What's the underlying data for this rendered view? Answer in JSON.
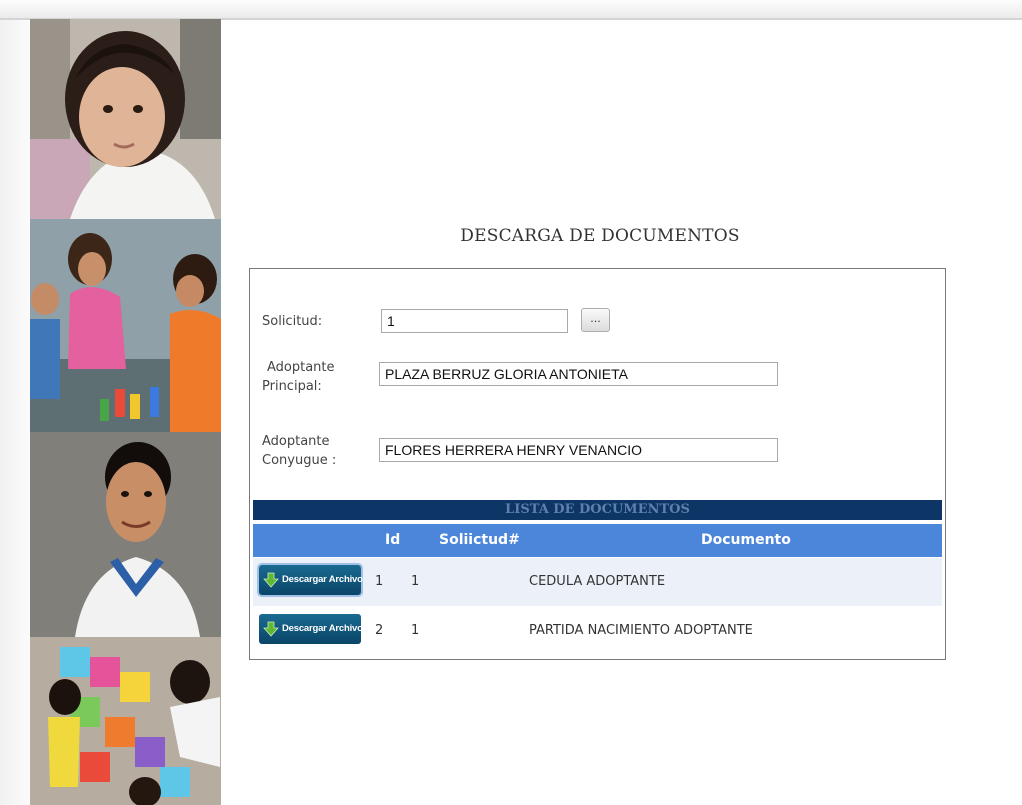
{
  "page": {
    "title": "DESCARGA DE DOCUMENTOS"
  },
  "form": {
    "solicitud_label": "Solicitud:",
    "solicitud_value": "1",
    "lookup_button": "...",
    "principal_label_1": "Adoptante",
    "principal_label_2": "Principal:",
    "principal_value": "PLAZA BERRUZ GLORIA ANTONIETA",
    "conyugue_label_1": "Adoptante",
    "conyugue_label_2": "Conyugue :",
    "conyugue_value": "FLORES HERRERA HENRY VENANCIO"
  },
  "documents": {
    "title": "LISTA DE DOCUMENTOS",
    "headers": {
      "id": "Id",
      "solicitud": "Soliictud#",
      "documento": "Documento"
    },
    "rows": [
      {
        "button": "Descargar Archivo",
        "id": "1",
        "solicitud": "1",
        "documento": "CEDULA ADOPTANTE"
      },
      {
        "button": "Descargar Archivo",
        "id": "2",
        "solicitud": "1",
        "documento": "PARTIDA NACIMIENTO ADOPTANTE"
      }
    ]
  },
  "colors": {
    "list_title_bg": "#0d3566",
    "header_bg": "#4c86da",
    "row_alt_bg": "#ecf1f9",
    "button_bg": "#0a4568",
    "arrow_green": "#5fb832"
  },
  "icons": {
    "download": "down-arrow-icon",
    "photos": [
      "toddler-photo",
      "children-playing-photo",
      "boy-photo",
      "puzzle-mat-photo"
    ]
  }
}
